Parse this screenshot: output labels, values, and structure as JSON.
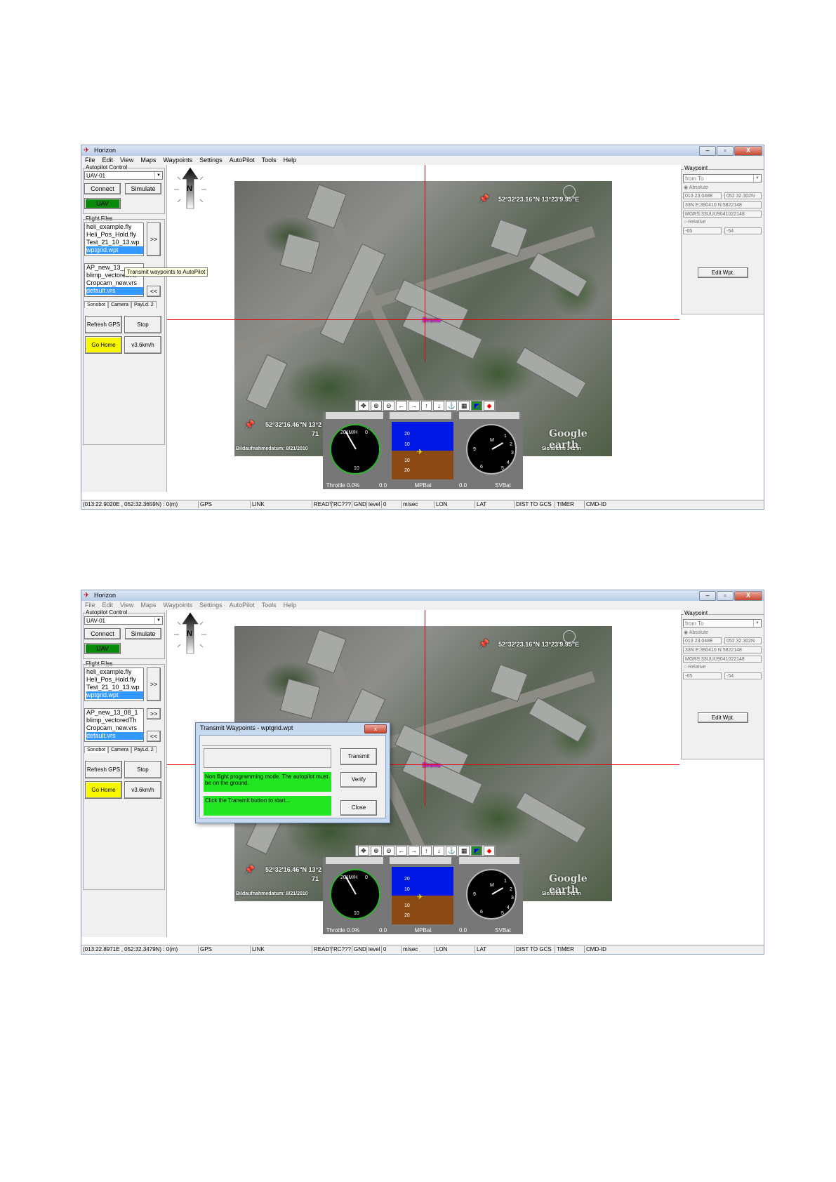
{
  "app_title": "Horizon",
  "menu": [
    "File",
    "Edit",
    "View",
    "Maps",
    "Waypoints",
    "Settings",
    "AutoPilot",
    "Tools",
    "Help"
  ],
  "left": {
    "autopilot_group": "Autopilot Control",
    "uav_select": "UAV-01",
    "connect": "Connect",
    "simulate": "Simulate",
    "uav": "UAV",
    "flight_files_group": "Flight Files",
    "flight_files": [
      "heli_example.fly",
      "Heli_Pos_Hold.fly",
      "Test_21_10_13.wp",
      "wptgrid.wpt"
    ],
    "fwd": ">>",
    "back": "<<",
    "vrs_files_top": [
      "AP_new_13_",
      "blimp_vectoredTh",
      "Cropcam_new.vrs",
      "default.vrs"
    ],
    "vrs_files_bottom": [
      "AP_new_13_08_1",
      "blimp_vectoredTh",
      "Cropcam_new.vrs",
      "default.vrs"
    ],
    "tabs": [
      "Sonobot",
      "Camera",
      "PayLd. 2"
    ],
    "refresh_gps": "Refresh GPS",
    "stop": "Stop",
    "go_home": "Go Home",
    "speed": "v3.6km/h"
  },
  "compass_letter": "N",
  "map": {
    "coord_top": "52°32'23.16\"N  13°23'9.95\"E",
    "coord_bottom": "52°32'16.46\"N  13°2",
    "small_num": "71",
    "imagery_date": "Bildaufnahmedatum: 8/21/2010",
    "eye_alt": "Sichthöhe    342 m",
    "watermark": "Google earth",
    "marker": "Drone"
  },
  "right": {
    "group": "Waypoint",
    "from_to": "from To",
    "absolute": "Absolute",
    "lon": "013 23.048E",
    "lat": "052 32.302N",
    "utm": "33N E:390410 N:5822148",
    "mgrs": "MGRS:33UUU9041022148",
    "relative": "Relative",
    "rel_a": "-65",
    "rel_b": "-54",
    "edit_wpt": "Edit Wpt."
  },
  "instruments": {
    "speed_unit": "KM/H",
    "speed_top_left": "20",
    "speed_top_right": "0",
    "speed_bottom": "10",
    "clock_letter": "M",
    "clock_nums": [
      "9",
      "1",
      "2",
      "3",
      "4",
      "5",
      "6"
    ],
    "horizon_marks": [
      "20",
      "10",
      "10",
      "20"
    ],
    "throttle": "Throttle 0.0%",
    "mp_val": "0.0",
    "mp_label": "MPBat",
    "sv_val": "0.0",
    "sv_label": "SVBat"
  },
  "tooltip": "Transmit waypoints to AutoPilot",
  "dialog": {
    "title": "Transmit Waypoints - wptgrid.wpt",
    "close_glyph": "x",
    "transmit": "Transmit",
    "verify": "Verify",
    "close": "Close",
    "msg1": "Non flight programming mode. The autopilot must be on the ground.",
    "msg2": "Click the Transmit button to start..."
  },
  "status_top": [
    "(013:22.9020E , 052:32.3659N) : 0(m)",
    "GPS",
    "LINK",
    "READY",
    "RC???",
    "GND",
    "level",
    "0",
    "m/sec",
    "LON",
    "LAT",
    "DIST TO GCS",
    "TIMER",
    "CMD-ID"
  ],
  "status_bottom": [
    "(013:22.8971E , 052:32.3479N) : 0(m)",
    "GPS",
    "LINK",
    "READY",
    "RC???",
    "GND",
    "level",
    "0",
    "m/sec",
    "LON",
    "LAT",
    "DIST TO GCS",
    "TIMER",
    "CMD-ID"
  ],
  "window_buttons": [
    "–",
    "▫",
    "X"
  ]
}
